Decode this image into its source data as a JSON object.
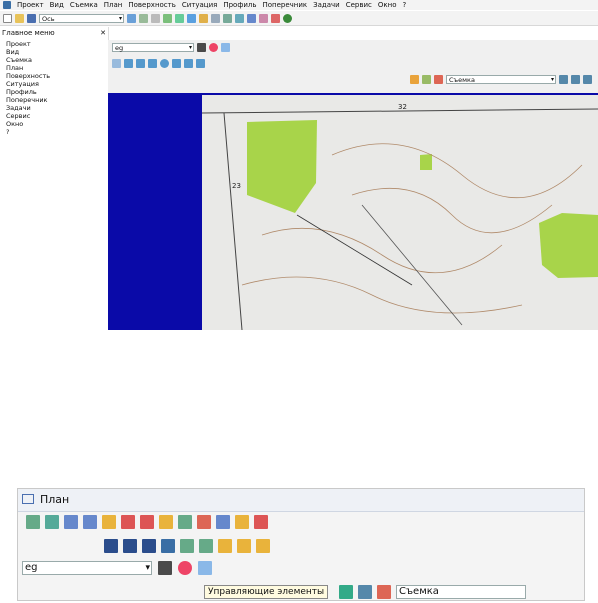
{
  "menubar": {
    "items": [
      "Проект",
      "Вид",
      "Съемка",
      "План",
      "Поверхность",
      "Ситуация",
      "Профиль",
      "Поперечник",
      "Задачи",
      "Сервис",
      "Окно",
      "?"
    ]
  },
  "toolbar_top": {
    "combo_value": "Ось"
  },
  "sidebar": {
    "title": "Главное меню",
    "close": "✕",
    "items": [
      "Проект",
      "Вид",
      "Съемка",
      "План",
      "Поверхность",
      "Ситуация",
      "Профиль",
      "Поперечник",
      "Задачи",
      "Сервис",
      "Окно",
      "?"
    ]
  },
  "panel": {
    "layer_combo": "eg",
    "survey_combo": "Съемка"
  },
  "map": {
    "labels": [
      "32",
      "23"
    ]
  },
  "zoom_panel": {
    "title": "План",
    "layer_combo": "eg",
    "survey_combo": "Съемка",
    "tooltip": "Управляющие элементы"
  },
  "colors": {
    "blue_frame": "#0a0aa8",
    "forest": "#a8d44a",
    "contour": "#b08a6a"
  }
}
